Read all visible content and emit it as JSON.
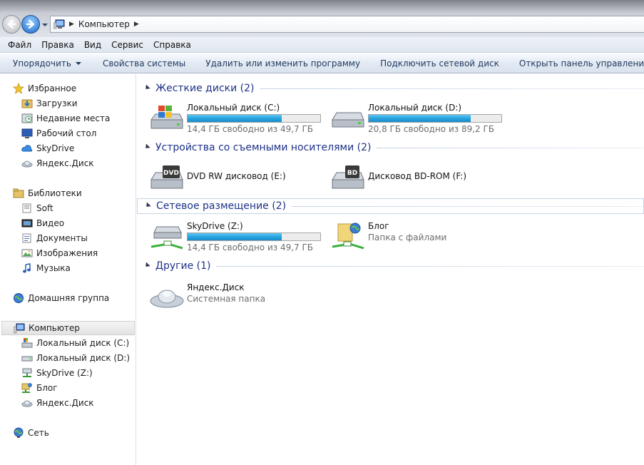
{
  "address": {
    "path": [
      "Компьютер"
    ]
  },
  "menu": [
    "Файл",
    "Правка",
    "Вид",
    "Сервис",
    "Справка"
  ],
  "commands": [
    {
      "label": "Упорядочить",
      "has_menu": true
    },
    {
      "label": "Свойства системы"
    },
    {
      "label": "Удалить или изменить программу"
    },
    {
      "label": "Подключить сетевой диск"
    },
    {
      "label": "Открыть панель управления"
    }
  ],
  "sidebar": {
    "favorites": {
      "label": "Избранное",
      "icon": "star-icon",
      "items": [
        {
          "label": "Загрузки",
          "icon": "downloads-icon"
        },
        {
          "label": "Недавние места",
          "icon": "recent-places-icon"
        },
        {
          "label": "Рабочий стол",
          "icon": "desktop-icon"
        },
        {
          "label": "SkyDrive",
          "icon": "skydrive-icon"
        },
        {
          "label": "Яндекс.Диск",
          "icon": "yandex-disk-icon"
        }
      ]
    },
    "libraries": {
      "label": "Библиотеки",
      "icon": "libraries-icon",
      "items": [
        {
          "label": "Soft",
          "icon": "library-icon"
        },
        {
          "label": "Видео",
          "icon": "video-icon"
        },
        {
          "label": "Документы",
          "icon": "documents-icon"
        },
        {
          "label": "Изображения",
          "icon": "pictures-icon"
        },
        {
          "label": "Музыка",
          "icon": "music-icon"
        }
      ]
    },
    "homegroup": {
      "label": "Домашняя группа",
      "icon": "homegroup-icon"
    },
    "computer": {
      "label": "Компьютер",
      "icon": "computer-icon",
      "items": [
        {
          "label": "Локальный диск (C:)",
          "icon": "hdd-icon"
        },
        {
          "label": "Локальный диск (D:)",
          "icon": "hdd-icon"
        },
        {
          "label": "SkyDrive (Z:)",
          "icon": "network-drive-icon"
        },
        {
          "label": "Блог",
          "icon": "network-folder-icon"
        },
        {
          "label": "Яндекс.Диск",
          "icon": "yandex-disk-icon"
        }
      ]
    },
    "network": {
      "label": "Сеть",
      "icon": "network-icon"
    }
  },
  "groups": {
    "hdd": {
      "title": "Жесткие диски (2)"
    },
    "removable": {
      "title": "Устройства со съемными носителями (2)"
    },
    "netloc": {
      "title": "Сетевое размещение (2)"
    },
    "other": {
      "title": "Другие (1)"
    }
  },
  "tiles": {
    "c": {
      "name": "Локальный диск (C:)",
      "status": "14,4 ГБ свободно из 49,7 ГБ",
      "used_fraction": 0.71
    },
    "d": {
      "name": "Локальный диск (D:)",
      "status": "20,8 ГБ свободно из 89,2 ГБ",
      "used_fraction": 0.77
    },
    "e": {
      "name": "DVD RW дисковод (E:)",
      "badge": "DVD"
    },
    "f": {
      "name": "Дисковод BD-ROM (F:)",
      "badge": "BD"
    },
    "z": {
      "name": "SkyDrive (Z:)",
      "status": "14,4 ГБ свободно из 49,7 ГБ",
      "used_fraction": 0.71
    },
    "blog": {
      "name": "Блог",
      "status": "Папка с файлами"
    },
    "yandex": {
      "name": "Яндекс.Диск",
      "status": "Системная папка"
    }
  },
  "colors": {
    "accent_text": "#1e3287",
    "bar_fill": "#27a4e0",
    "command_text": "#1e395b"
  }
}
